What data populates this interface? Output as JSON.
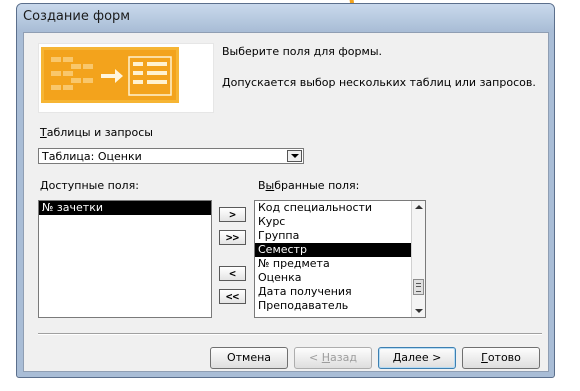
{
  "window": {
    "title": "Создание форм"
  },
  "intro": {
    "line1": "Выберите поля для формы.",
    "line2": "Допускается выбор нескольких таблиц или запросов."
  },
  "tables": {
    "label_u": "Т",
    "label_rest": "аблицы и запросы",
    "selected": "Таблица: Оценки"
  },
  "available": {
    "label_u": "Д",
    "label_rest": "оступные поля:",
    "items": [
      "№ зачетки"
    ],
    "selected_index": 0
  },
  "chosen": {
    "label_pre": "В",
    "label_u": "ы",
    "label_rest": "бранные поля:",
    "items": [
      "Код специальности",
      "Курс",
      "Группа",
      "Семестр",
      "№ предмета",
      "Оценка",
      "Дата получения",
      "Преподаватель"
    ],
    "selected_index": 3
  },
  "move_buttons": {
    "add": ">",
    "add_all": ">>",
    "remove": "<",
    "remove_all": "<<"
  },
  "buttons": {
    "cancel": "Отмена",
    "back_pre": "< ",
    "back_u": "Н",
    "back_rest": "азад",
    "next_u": "Д",
    "next_rest": "алее >",
    "finish_u": "Г",
    "finish_rest": "отово"
  },
  "colors": {
    "title_bar": "#a9bdd6",
    "dialog_bg": "#f0f0f0",
    "selection": "#000000",
    "preview_accent": "#f3a31c"
  },
  "icons": [
    "dropdown-arrow-icon",
    "scroll-up-icon",
    "scroll-down-icon",
    "form-wizard-illustration"
  ]
}
